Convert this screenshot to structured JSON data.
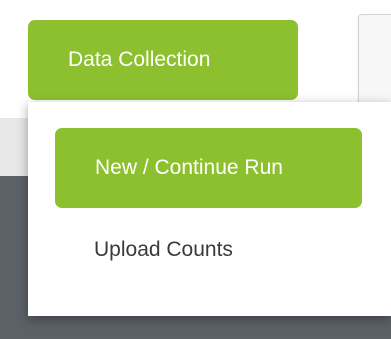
{
  "tab": {
    "label": "Data Collection"
  },
  "dropdown": {
    "items": [
      {
        "label": "New / Continue Run",
        "active": true
      },
      {
        "label": "Upload Counts",
        "active": false
      }
    ]
  },
  "colors": {
    "accent": "#8dc02f",
    "background_dark": "#5b6167",
    "background_light": "#e7e7e7"
  }
}
